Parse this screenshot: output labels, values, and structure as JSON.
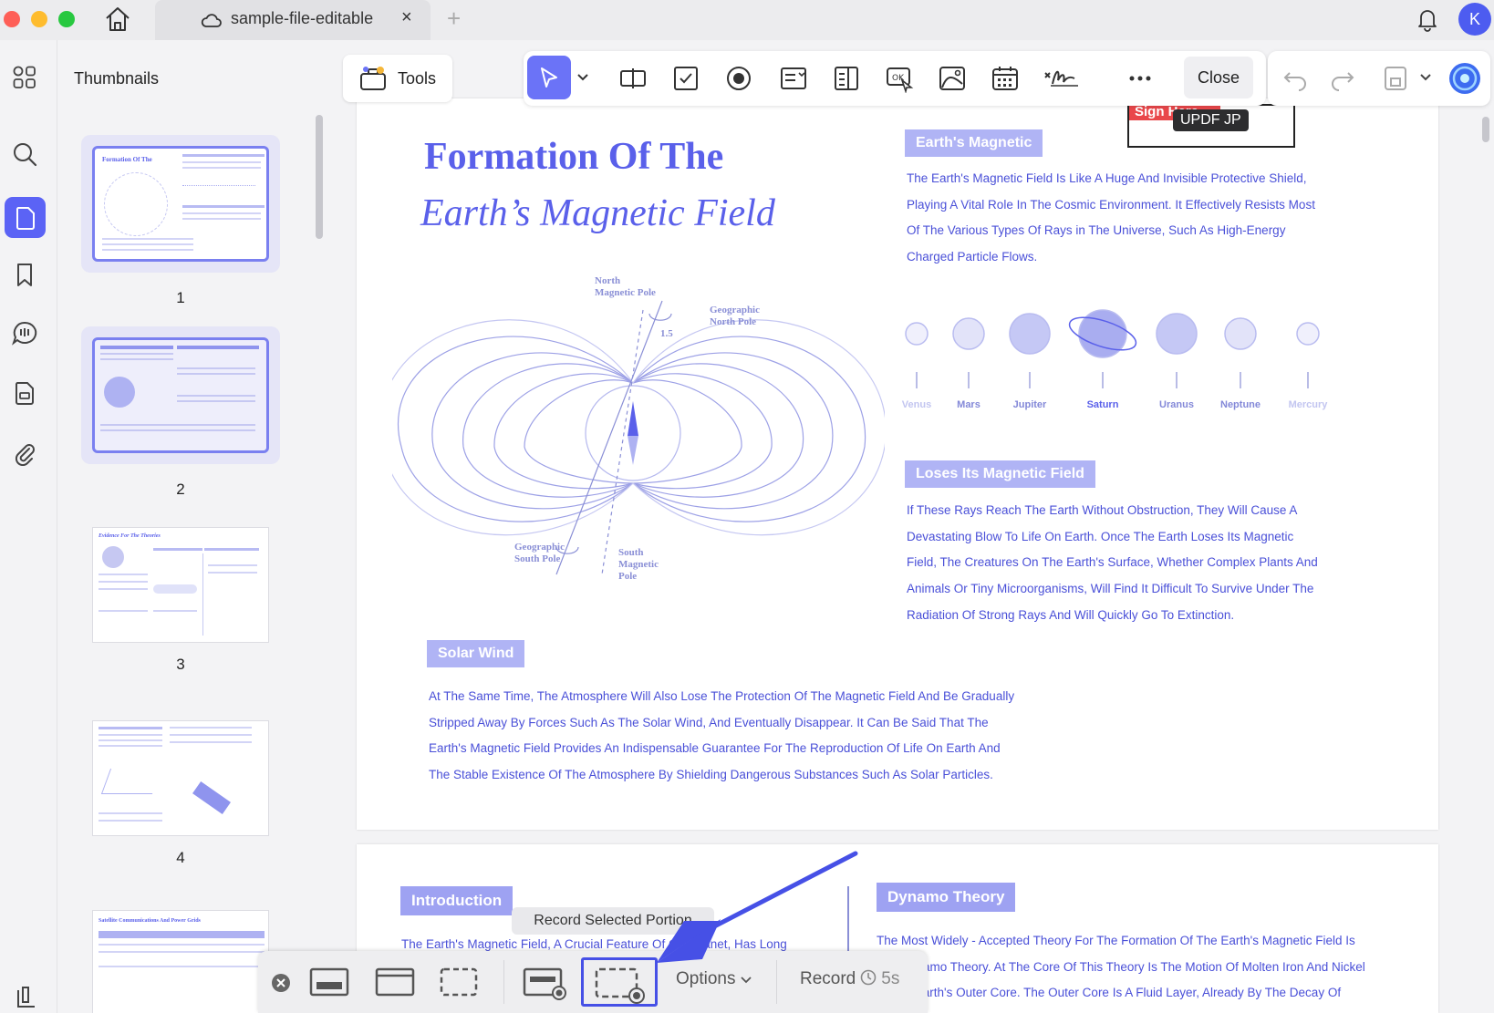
{
  "titlebar": {
    "tab_title": "sample-file-editable",
    "tab_close": "×",
    "new_tab": "+",
    "avatar_letter": "K"
  },
  "sidebar": {
    "title": "Thumbnails",
    "pages": [
      "1",
      "2",
      "3",
      "4"
    ],
    "thumb_titles": {
      "p1": "Formation Of The",
      "p3": "Evidence For The Theories",
      "p5": "Satellite Communications And Power Grids"
    }
  },
  "toolbar": {
    "tools_label": "Tools",
    "close_label": "Close"
  },
  "signature": {
    "label": "Sign Here",
    "tooltip": "UPDF JP"
  },
  "document": {
    "title_line1": "Formation Of The",
    "title_line2": "Earth’s Magnetic Field",
    "diagram": {
      "north_magnetic_pole": [
        "North",
        "Magnetic Pole"
      ],
      "geographic_north_pole": [
        "Geographic",
        "North Pole"
      ],
      "angle": "1.5",
      "geographic_south_pole": [
        "Geographic",
        "South Pole"
      ],
      "south_magnetic_pole": [
        "South",
        "Magnetic",
        "Pole"
      ]
    },
    "planets": [
      "Venus",
      "Mars",
      "Jupiter",
      "Saturn",
      "Uranus",
      "Neptune",
      "Mercury"
    ],
    "sections": {
      "earths_magnetic": {
        "label": "Earth's Magnetic",
        "lines": [
          "The Earth's Magnetic Field Is Like A Huge And Invisible Protective Shield,",
          "Playing A Vital Role In The Cosmic Environment. It Effectively Resists Most",
          "Of The Various Types Of Rays in The Universe, Such As High-Energy",
          "Charged Particle Flows."
        ]
      },
      "loses_field": {
        "label": "Loses Its Magnetic Field",
        "lines": [
          "If These Rays Reach The Earth Without Obstruction, They Will Cause A",
          "Devastating Blow To Life On Earth. Once The Earth Loses Its Magnetic",
          "Field, The Creatures On The Earth's Surface, Whether Complex Plants And",
          "Animals Or Tiny Microorganisms, Will Find It Difficult To Survive Under The",
          "Radiation Of Strong Rays And Will Quickly Go To Extinction."
        ]
      },
      "solar_wind": {
        "label": "Solar Wind",
        "lines": [
          "At The Same Time, The Atmosphere Will Also Lose The Protection Of The Magnetic Field And Be Gradually",
          "Stripped Away By Forces Such As The Solar Wind, And Eventually Disappear. It Can Be Said That The",
          "Earth's Magnetic Field Provides An Indispensable Guarantee For The Reproduction Of Life On Earth And",
          "The Stable Existence Of The Atmosphere By Shielding Dangerous Substances Such As Solar Particles."
        ]
      },
      "introduction": {
        "label": "Introduction",
        "lines": [
          "The Earth's Magnetic Field, A Crucial Feature Of Our Planet, Has Long"
        ]
      },
      "dynamo": {
        "label": "Dynamo Theory",
        "lines": [
          "The Most Widely - Accepted Theory For The Formation Of The Earth's Magnetic Field Is",
          "The Dynamo Theory. At The Core Of This Theory Is The Motion Of Molten Iron And Nickel",
          "In The Earth's Outer Core. The Outer Core Is A Fluid Layer, Already By The Decay Of"
        ]
      }
    }
  },
  "recorder": {
    "tooltip": "Record Selected Portion",
    "options_label": "Options",
    "record_label": "Record",
    "timer": "5s"
  },
  "colors": {
    "accent": "#5b63f5",
    "doc_text": "#4a50d8",
    "section_bg": "#b0b4f5",
    "arrow": "#4650e6"
  }
}
